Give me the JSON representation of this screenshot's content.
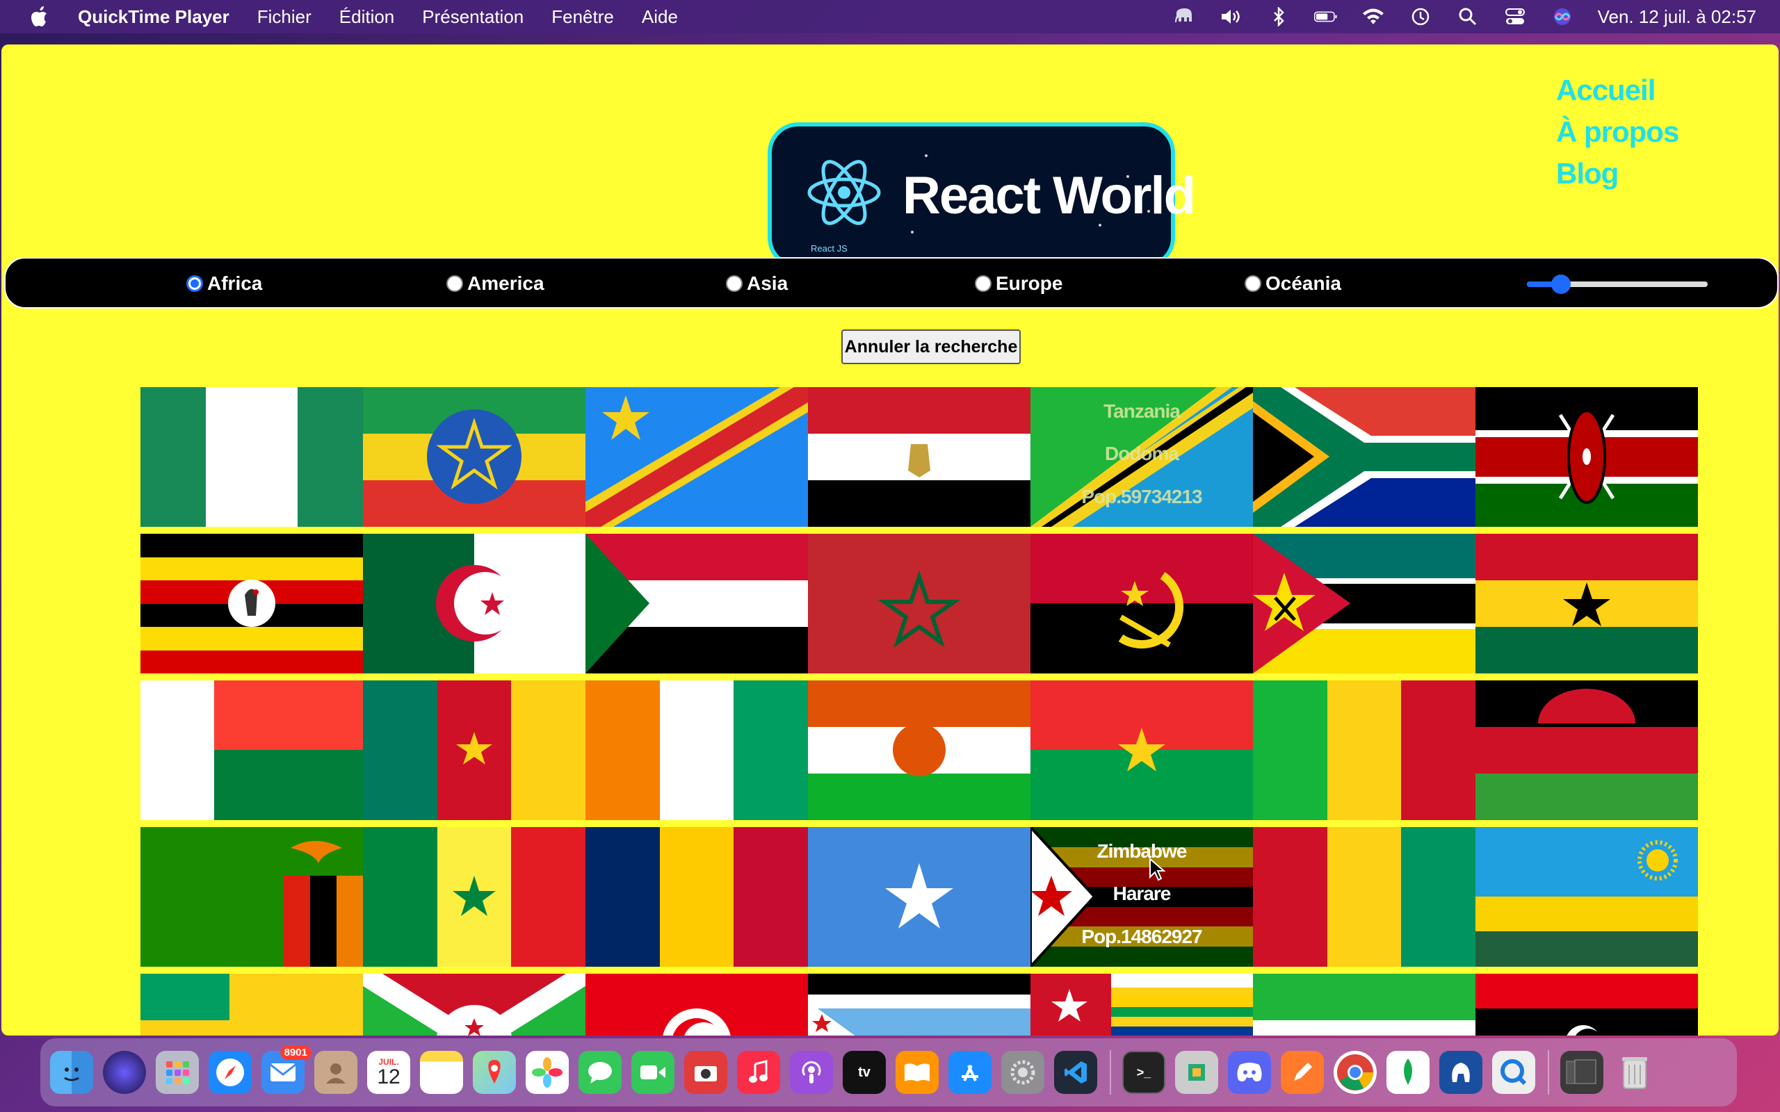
{
  "menubar": {
    "app_name": "QuickTime Player",
    "menus": [
      "Fichier",
      "Édition",
      "Présentation",
      "Fenêtre",
      "Aide"
    ],
    "clock": "Ven. 12 juil. à  02:57",
    "status_icons": [
      "elephant-icon",
      "volume-icon",
      "bluetooth-icon",
      "battery-icon",
      "wifi-icon",
      "time-machine-icon",
      "spotlight-search-icon",
      "control-center-icon",
      "siri-icon"
    ]
  },
  "header": {
    "logo_caption": "React JS",
    "logo_title": "React World",
    "nav": [
      "Accueil",
      "À propos",
      "Blog"
    ]
  },
  "filters": {
    "regions": [
      "Africa",
      "America",
      "Asia",
      "Europe",
      "Océania"
    ],
    "selected": "Africa",
    "range_value": 0.15
  },
  "cancel_label": "Annuler la recherche",
  "cards": {
    "tanzania": {
      "name": "Tanzania",
      "capital": "Dodoma",
      "population": "Pop.59734213"
    },
    "zimbabwe": {
      "name": "Zimbabwe",
      "capital": "Harare",
      "population": "Pop.14862927"
    }
  },
  "dock": {
    "mail_badge": "8901",
    "calendar_month": "JUIL.",
    "calendar_day": "12",
    "apps": [
      "finder",
      "siri",
      "launchpad",
      "safari",
      "mail",
      "contacts",
      "calendar",
      "notes",
      "maps",
      "photos",
      "messages",
      "facetime",
      "photo-booth",
      "music",
      "podcasts",
      "apple-tv",
      "books",
      "app-store",
      "system-preferences",
      "vscode",
      "terminal",
      "system-information",
      "discord",
      "pencil",
      "chrome",
      "mongodb",
      "tableplus",
      "quicktime",
      "downloads-stack",
      "trash"
    ]
  },
  "colors": {
    "page_bg": "#ffff33",
    "accent": "#20e0e8",
    "bar": "#000000"
  }
}
